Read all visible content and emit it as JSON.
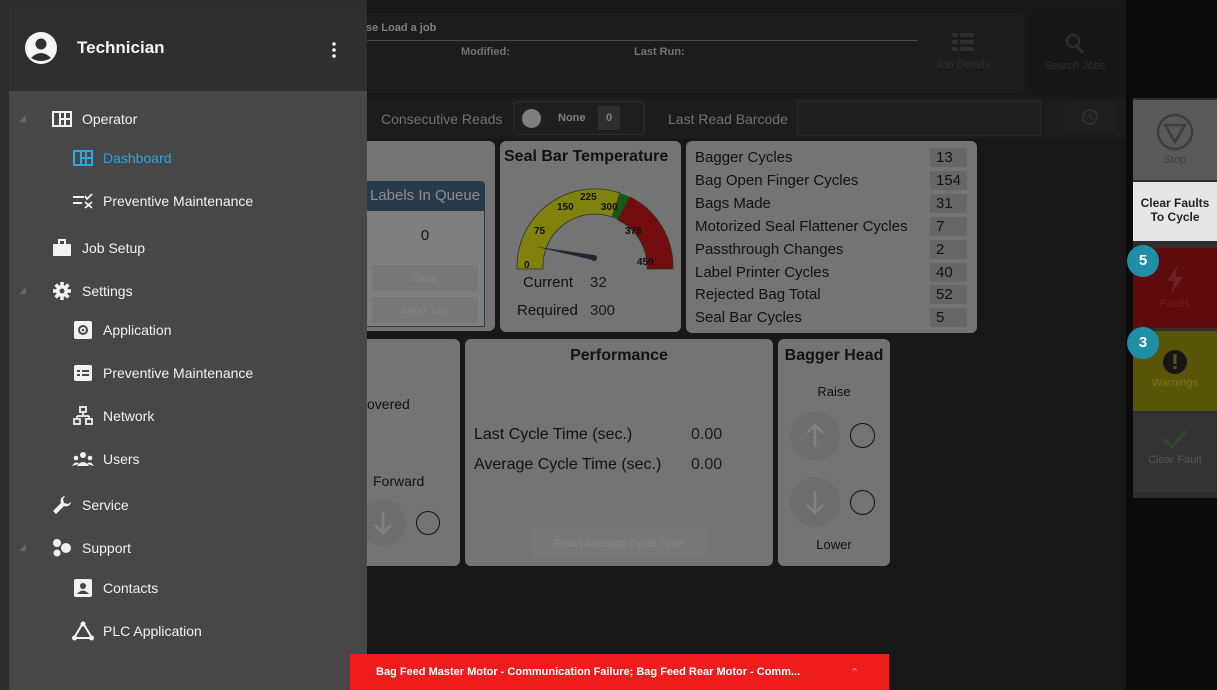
{
  "top_bar": {
    "job_prompt": "se Load a job",
    "modified_label": "Modified:",
    "last_run_label": "Last Run:",
    "job_details_label": "Job Details",
    "search_jobs_label": "Search Jobs"
  },
  "reads_bar": {
    "consecutive_reads_label": "Consecutive Reads",
    "none_label": "None",
    "count_value": "0",
    "last_read_barcode_label": "Last Read Barcode",
    "last_read_barcode_value": ""
  },
  "labels_queue": {
    "title": "Labels In Queue",
    "count": "0",
    "clear_label": "Clear",
    "send_test_label": "Send Test"
  },
  "seal_bar": {
    "title": "Seal Bar Temperature",
    "gauge_ticks": [
      "0",
      "75",
      "150",
      "225",
      "300",
      "375",
      "450"
    ],
    "gauge_value": 32,
    "gauge_max": 450,
    "current_label": "Current",
    "current_value": "32",
    "required_label": "Required",
    "required_value": "300"
  },
  "counters": [
    {
      "label": "Bagger Cycles",
      "value": "13"
    },
    {
      "label": "Bag Open Finger Cycles",
      "value": "154"
    },
    {
      "label": "Bags Made",
      "value": "31"
    },
    {
      "label": "Motorized Seal Flattener Cycles",
      "value": "7"
    },
    {
      "label": "Passthrough Changes",
      "value": "2"
    },
    {
      "label": "Label Printer Cycles",
      "value": "40"
    },
    {
      "label": "Rejected Bag Total",
      "value": "52"
    },
    {
      "label": "Seal Bar Cycles",
      "value": "5"
    }
  ],
  "partial_card": {
    "text1": "overed",
    "text2": "Forward"
  },
  "performance": {
    "title": "Performance",
    "last_cycle_label": "Last Cycle Time (sec.)",
    "last_cycle_value": "0.00",
    "avg_cycle_label": "Average Cycle Time (sec.)",
    "avg_cycle_value": "0.00",
    "reset_label": "Reset Average Cycle Time"
  },
  "bagger_head": {
    "title": "Bagger Head",
    "raise_label": "Raise",
    "lower_label": "Lower"
  },
  "side_panel": {
    "stop_label": "Stop",
    "clear_faults_label_1": "Clear Faults",
    "clear_faults_label_2": "To Cycle",
    "faults_count": "5",
    "faults_label": "Faults",
    "warnings_count": "3",
    "warnings_label": "Warnings",
    "clear_fault_label": "Clear Fault"
  },
  "drawer": {
    "user_name": "Technician",
    "items": [
      {
        "label": "Operator"
      },
      {
        "label": "Dashboard"
      },
      {
        "label": "Preventive Maintenance"
      },
      {
        "label": "Job Setup"
      },
      {
        "label": "Settings"
      },
      {
        "label": "Application"
      },
      {
        "label": "Preventive Maintenance"
      },
      {
        "label": "Network"
      },
      {
        "label": "Users"
      },
      {
        "label": "Service"
      },
      {
        "label": "Support"
      },
      {
        "label": "Contacts"
      },
      {
        "label": "PLC Application"
      }
    ]
  },
  "alert": {
    "message": "Bag Feed Master Motor - Communication Failure; Bag Feed Rear Motor - Comm..."
  },
  "colors": {
    "accent": "#29a9e1",
    "alert_red": "#ee1c1c",
    "faults_red": "#b3131b",
    "warnings_yellow": "#c7c10e",
    "badge_teal": "#1e8fa6"
  }
}
